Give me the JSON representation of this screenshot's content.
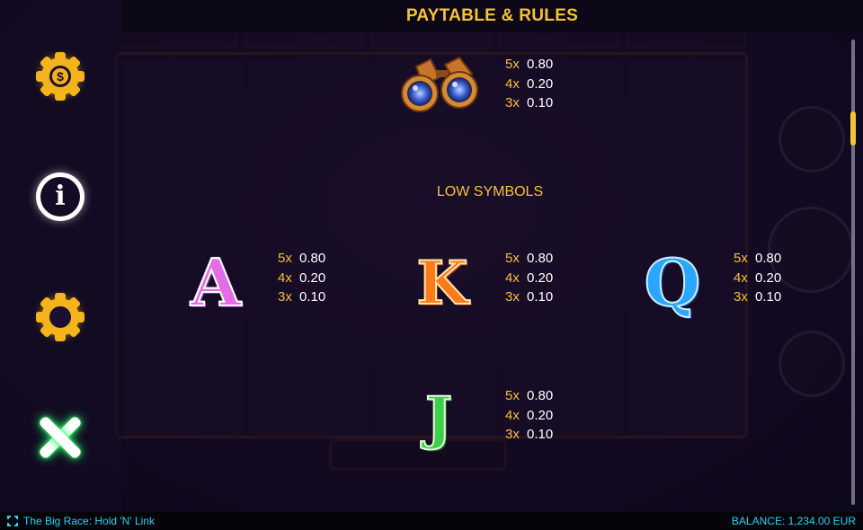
{
  "header": {
    "title": "PAYTABLE & RULES"
  },
  "side_menu": [
    {
      "icon": "dollar-gear-icon"
    },
    {
      "icon": "info-icon"
    },
    {
      "icon": "settings-gear-icon"
    },
    {
      "icon": "close-icon"
    }
  ],
  "paytable": {
    "binoculars": {
      "icon": "binoculars-icon",
      "pays": [
        {
          "mult": "5x",
          "value": "0.80"
        },
        {
          "mult": "4x",
          "value": "0.20"
        },
        {
          "mult": "3x",
          "value": "0.10"
        }
      ]
    },
    "low_symbols_title": "LOW SYMBOLS",
    "A": {
      "glyph": "A",
      "pays": [
        {
          "mult": "5x",
          "value": "0.80"
        },
        {
          "mult": "4x",
          "value": "0.20"
        },
        {
          "mult": "3x",
          "value": "0.10"
        }
      ]
    },
    "K": {
      "glyph": "K",
      "pays": [
        {
          "mult": "5x",
          "value": "0.80"
        },
        {
          "mult": "4x",
          "value": "0.20"
        },
        {
          "mult": "3x",
          "value": "0.10"
        }
      ]
    },
    "Q": {
      "glyph": "Q",
      "pays": [
        {
          "mult": "5x",
          "value": "0.80"
        },
        {
          "mult": "4x",
          "value": "0.20"
        },
        {
          "mult": "3x",
          "value": "0.10"
        }
      ]
    },
    "J": {
      "glyph": "J",
      "pays": [
        {
          "mult": "5x",
          "value": "0.80"
        },
        {
          "mult": "4x",
          "value": "0.20"
        },
        {
          "mult": "3x",
          "value": "0.10"
        }
      ]
    }
  },
  "footer": {
    "game_name": "The Big Race: Hold 'N' Link",
    "balance": "BALANCE: 1,234.00 EUR"
  },
  "colors": {
    "accent": "#f7c236",
    "footer_text": "#27d3f0",
    "close_glow": "#2fff6a"
  }
}
